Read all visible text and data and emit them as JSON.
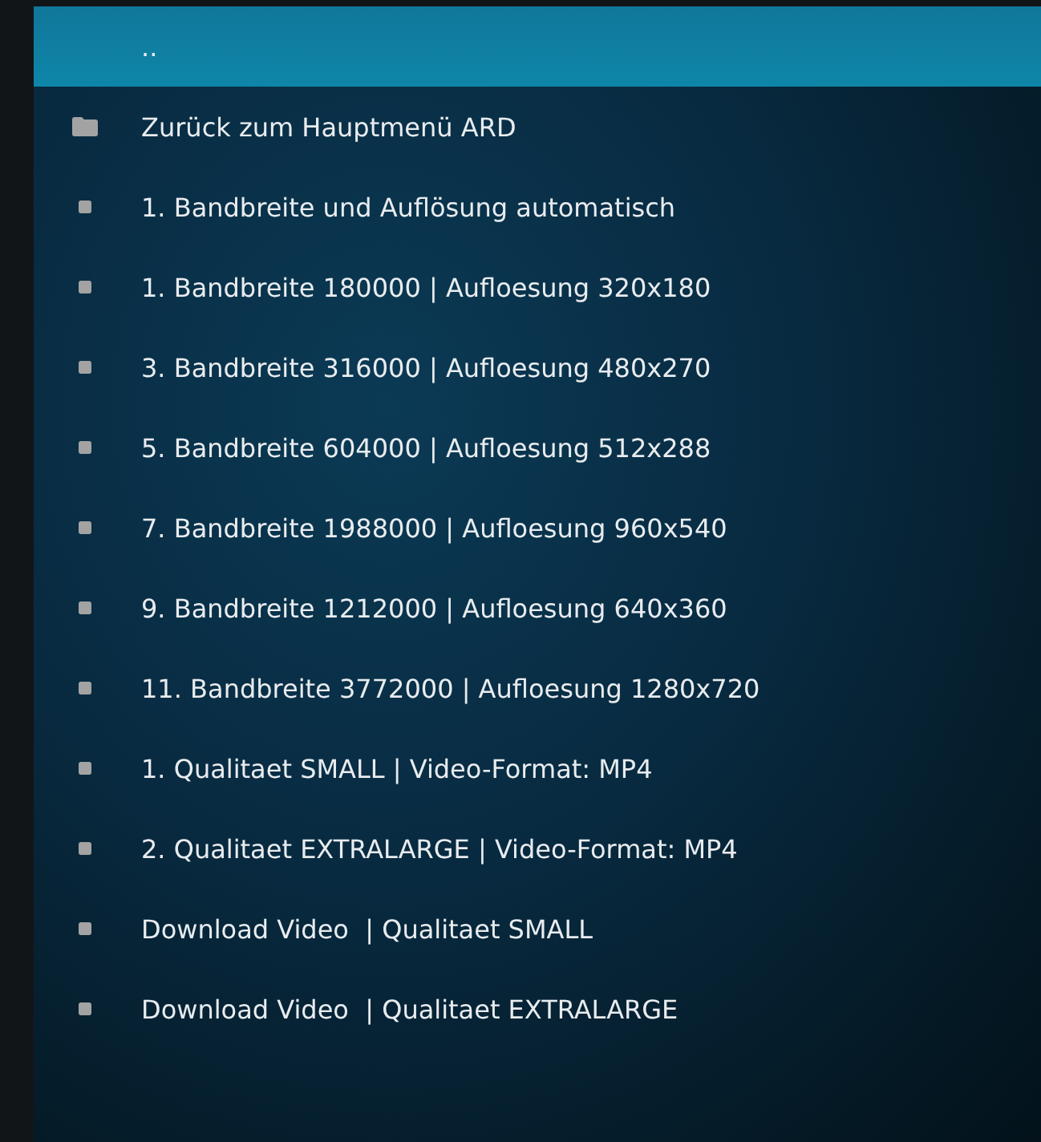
{
  "items": [
    {
      "label": "..",
      "kind": "parent",
      "selected": true
    },
    {
      "label": "Zurück zum Hauptmenü ARD",
      "kind": "folder",
      "selected": false
    },
    {
      "label": "1. Bandbreite und Auflösung automatisch",
      "kind": "file",
      "selected": false
    },
    {
      "label": "1. Bandbreite 180000 | Aufloesung 320x180",
      "kind": "file",
      "selected": false
    },
    {
      "label": "3. Bandbreite 316000 | Aufloesung 480x270",
      "kind": "file",
      "selected": false
    },
    {
      "label": "5. Bandbreite 604000 | Aufloesung 512x288",
      "kind": "file",
      "selected": false
    },
    {
      "label": "7. Bandbreite 1988000 | Aufloesung 960x540",
      "kind": "file",
      "selected": false
    },
    {
      "label": "9. Bandbreite 1212000 | Aufloesung 640x360",
      "kind": "file",
      "selected": false
    },
    {
      "label": "11. Bandbreite 3772000 | Aufloesung 1280x720",
      "kind": "file",
      "selected": false
    },
    {
      "label": "1. Qualitaet SMALL | Video-Format: MP4",
      "kind": "file",
      "selected": false
    },
    {
      "label": "2. Qualitaet EXTRALARGE | Video-Format: MP4",
      "kind": "file",
      "selected": false
    },
    {
      "label": "Download Video  | Qualitaet SMALL",
      "kind": "file",
      "selected": false
    },
    {
      "label": "Download Video  | Qualitaet EXTRALARGE",
      "kind": "file",
      "selected": false
    }
  ]
}
